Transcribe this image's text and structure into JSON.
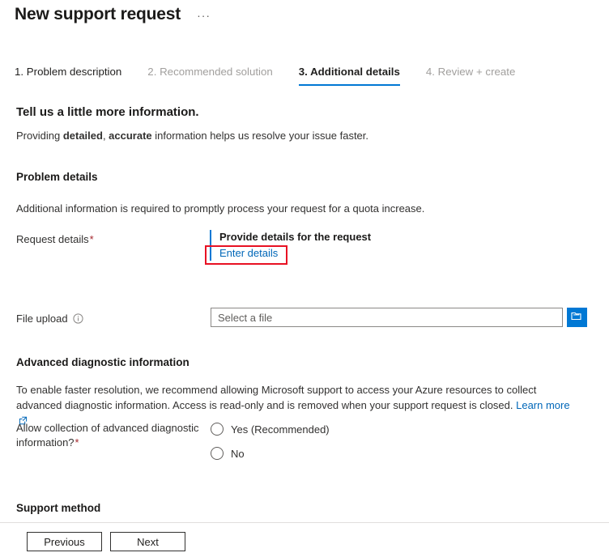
{
  "header": {
    "title": "New support request",
    "ellipsis": "···"
  },
  "tabs": [
    {
      "label": "1. Problem description",
      "state": "done"
    },
    {
      "label": "2. Recommended solution",
      "state": "disabled"
    },
    {
      "label": "3. Additional details",
      "state": "active"
    },
    {
      "label": "4. Review + create",
      "state": "disabled"
    }
  ],
  "main": {
    "heading": "Tell us a little more information.",
    "subtext_part1": "Providing ",
    "subtext_bold1": "detailed",
    "subtext_part2": ", ",
    "subtext_bold2": "accurate",
    "subtext_part3": " information helps us resolve your issue faster.",
    "problem_details": {
      "title": "Problem details",
      "description": "Additional information is required to promptly process your request for a quota increase.",
      "request_details_label": "Request details",
      "request_required_marker": "*",
      "provide_details_title": "Provide details for the request",
      "enter_details_link": "Enter details"
    },
    "file_upload": {
      "label": "File upload",
      "info_icon": "info-circle-icon",
      "input_value": "",
      "input_placeholder": "Select a file",
      "browse_icon": "folder-browse-icon"
    },
    "advanced": {
      "title": "Advanced diagnostic information",
      "description": "To enable faster resolution, we recommend allowing Microsoft support to access your Azure resources to collect advanced diagnostic information. Access is read-only and is removed when your support request is closed. ",
      "learn_more": "Learn more",
      "external_icon": "external-link-icon",
      "radio_question": "Allow collection of advanced diagnostic information?",
      "radio_required_marker": "*",
      "options": [
        {
          "label": "Yes (Recommended)",
          "selected": false
        },
        {
          "label": "No",
          "selected": false
        }
      ]
    },
    "support_method": {
      "title": "Support method"
    }
  },
  "footer": {
    "previous_label": "Previous",
    "next_label": "Next"
  },
  "colors": {
    "accent_blue": "#0078d4",
    "link_blue": "#0067b8",
    "required_red": "#a4262c",
    "highlight_red": "#e81123",
    "disabled_gray": "#a19f9d"
  }
}
